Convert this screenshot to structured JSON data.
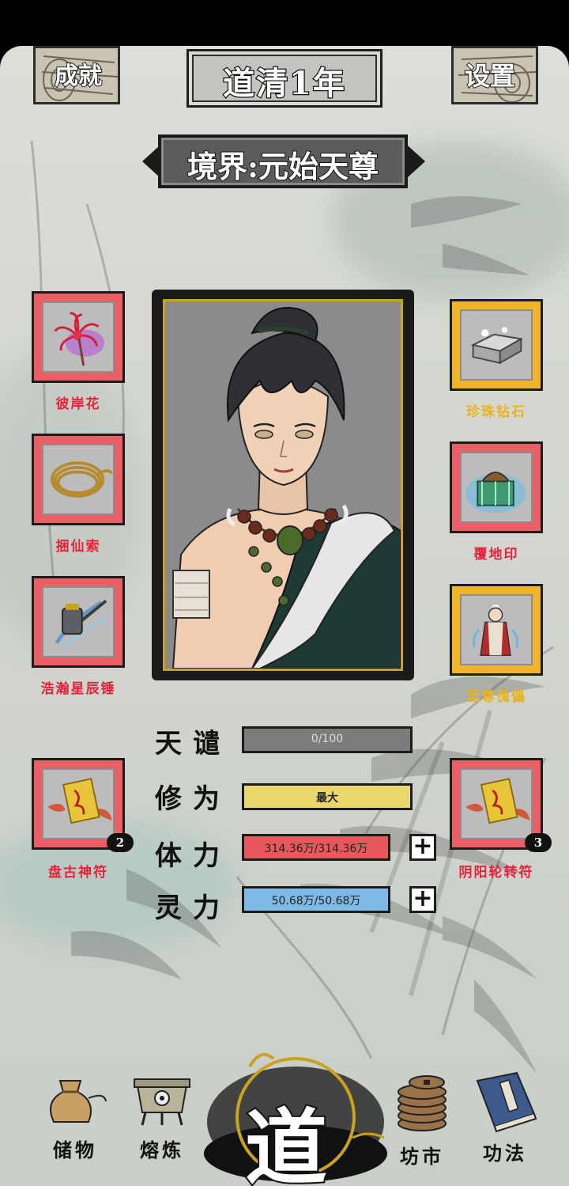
{
  "header": {
    "achievement_label": "成就",
    "settings_label": "设置",
    "year_title": "道清1年",
    "realm_title": "境界:元始天尊"
  },
  "left_items": [
    {
      "name": "彼岸花",
      "icon": "red-spider-lily-icon",
      "frame": "red"
    },
    {
      "name": "捆仙索",
      "icon": "rope-icon",
      "frame": "red"
    },
    {
      "name": "浩瀚星辰锤",
      "icon": "hammer-icon",
      "frame": "red"
    },
    {
      "name": "盘古神符",
      "icon": "talisman-icon",
      "frame": "red",
      "count": "2"
    }
  ],
  "right_items": [
    {
      "name": "珍珠钻石",
      "icon": "chest-icon",
      "frame": "gold"
    },
    {
      "name": "覆地印",
      "icon": "seal-icon",
      "frame": "red"
    },
    {
      "name": "至尊傀儡",
      "icon": "puppet-icon",
      "frame": "gold"
    },
    {
      "name": "阴阳轮转符",
      "icon": "talisman-icon",
      "frame": "red",
      "count": "3"
    }
  ],
  "stats": [
    {
      "label": "天谴",
      "value": "0/100",
      "color": "#7c7c7c"
    },
    {
      "label": "修为",
      "value": "最大",
      "color": "#ead86c"
    },
    {
      "label": "体力",
      "value": "314.36万/314.36万",
      "color": "#e8585b"
    },
    {
      "label": "灵力",
      "value": "50.68万/50.68万",
      "color": "#7fb9e6"
    }
  ],
  "nav": {
    "storage": "储物",
    "refine": "熔炼",
    "dao": "道",
    "market": "坊市",
    "skills": "功法"
  },
  "colors": {
    "red_frame": "#ea5f66",
    "gold_frame": "#f2b52a",
    "red_text": "#e8213a",
    "gold_text": "#e8b320"
  }
}
